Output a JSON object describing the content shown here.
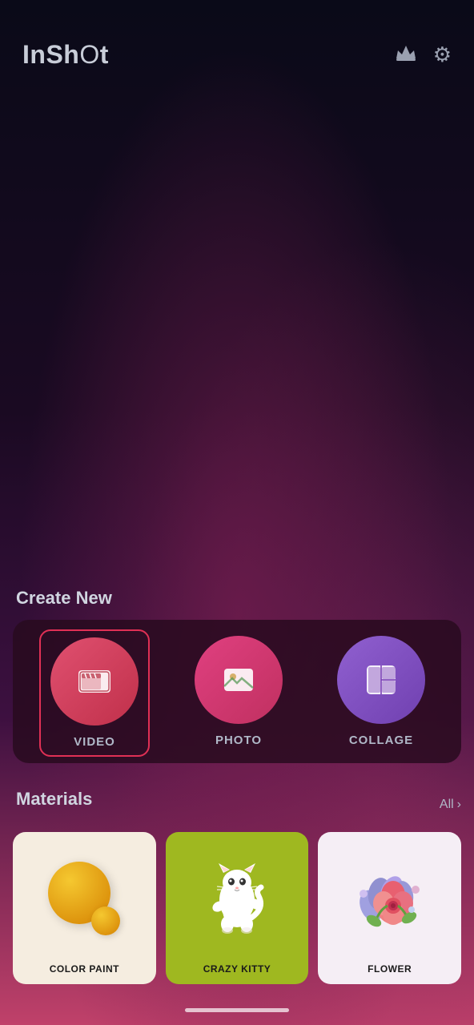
{
  "app": {
    "logo": "InShOt",
    "logo_parts": {
      "styled": "InSh",
      "lower": "Ot"
    }
  },
  "header": {
    "crown_icon": "♛",
    "settings_icon": "⚙"
  },
  "create_new": {
    "title": "Create New",
    "items": [
      {
        "id": "video",
        "label": "VIDEO",
        "selected": true
      },
      {
        "id": "photo",
        "label": "PHOTO",
        "selected": false
      },
      {
        "id": "collage",
        "label": "COLLAGE",
        "selected": false
      }
    ]
  },
  "materials": {
    "title": "Materials",
    "all_label": "All",
    "chevron": "›",
    "items": [
      {
        "id": "color-paint",
        "label": "COLOR PAINT",
        "bg": "light"
      },
      {
        "id": "crazy-kitty",
        "label": "CRAZY KITTY",
        "bg": "green"
      },
      {
        "id": "flower",
        "label": "FLOWER",
        "bg": "pink"
      }
    ]
  }
}
